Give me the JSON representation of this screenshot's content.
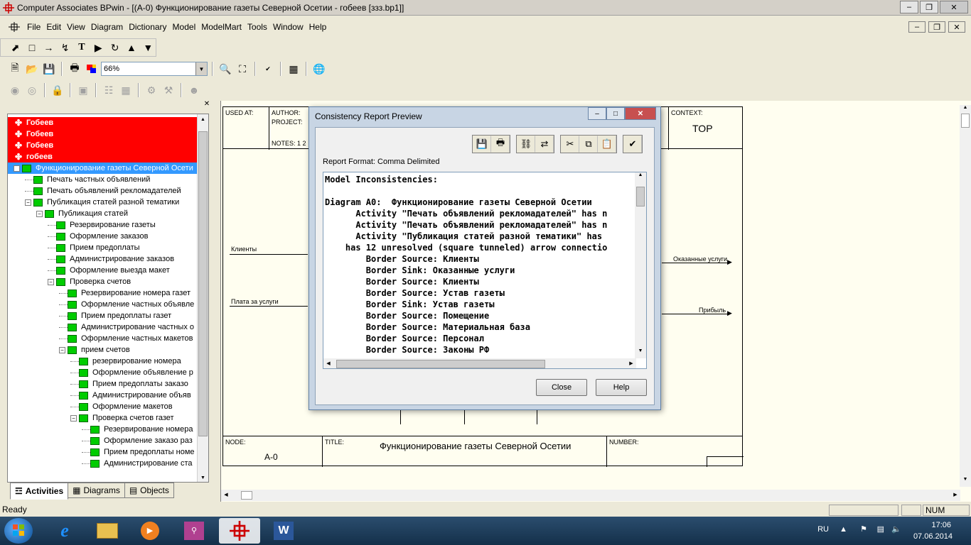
{
  "window": {
    "title": "Computer Associates BPwin - [(A-0) Функционирование газеты Северной Осетии - гобеев  [ззз.bp1]]"
  },
  "menu": [
    "File",
    "Edit",
    "View",
    "Diagram",
    "Dictionary",
    "Model",
    "ModelMart",
    "Tools",
    "Window",
    "Help"
  ],
  "toolbar": {
    "zoom": "66%"
  },
  "tree": {
    "red_items": [
      "Гобеев",
      "Гобеев",
      "Гобеев",
      "гобеев"
    ],
    "items": [
      {
        "label": "Функционирование газеты Северной Осети",
        "level": 0,
        "selected": true,
        "toggle": "−"
      },
      {
        "label": "Печать частных объявлений",
        "level": 1
      },
      {
        "label": "Печать объявлений рекломадателей",
        "level": 1
      },
      {
        "label": "Публикация статей разной тематики",
        "level": 1,
        "toggle": "−"
      },
      {
        "label": "Публикация статей",
        "level": 2,
        "toggle": "−"
      },
      {
        "label": "Резервирование газеты",
        "level": 3
      },
      {
        "label": "Оформление заказов",
        "level": 3
      },
      {
        "label": "Прием предоплаты",
        "level": 3
      },
      {
        "label": "Администрирование заказов",
        "level": 3
      },
      {
        "label": "Оформление выезда макет",
        "level": 3
      },
      {
        "label": "Проверка счетов",
        "level": 3,
        "toggle": "−"
      },
      {
        "label": "Резервирование номера газет",
        "level": 4
      },
      {
        "label": "Оформление частных объявле",
        "level": 4
      },
      {
        "label": "Прием предоплаты газет",
        "level": 4
      },
      {
        "label": "Администрирование частных о",
        "level": 4
      },
      {
        "label": "Оформление частных макетов",
        "level": 4
      },
      {
        "label": "прием счетов",
        "level": 4,
        "toggle": "−"
      },
      {
        "label": "резервирование номера",
        "level": 5
      },
      {
        "label": "Оформление объявление р",
        "level": 5
      },
      {
        "label": "Прием предоплаты заказо",
        "level": 5
      },
      {
        "label": "Администрирование объяв",
        "level": 5
      },
      {
        "label": "Оформление макетов",
        "level": 5
      },
      {
        "label": "Проверка счетов газет",
        "level": 5,
        "toggle": "−"
      },
      {
        "label": "Резервирование номера",
        "level": 6
      },
      {
        "label": "Оформление заказо раз",
        "level": 6
      },
      {
        "label": "Прием предоплаты номе",
        "level": 6
      },
      {
        "label": "Администрирование ста",
        "level": 6
      }
    ]
  },
  "tabs": [
    "Activities",
    "Diagrams",
    "Objects"
  ],
  "diagram": {
    "used_at": "USED AT:",
    "author": "AUTHOR:",
    "project": "PROJECT:",
    "notes": "NOTES:  1  2",
    "context": "CONTEXT:",
    "context_value": "TOP",
    "node_label": "NODE:",
    "node_value": "A-0",
    "title_label": "TITLE:",
    "title_value": "Функционирование газеты Северной Осетии",
    "number_label": "NUMBER:",
    "arrows": {
      "clients": "Клиенты",
      "payment": "Плата за услуги",
      "services": "Оказанные услуги",
      "profit": "Прибыль"
    }
  },
  "dialog": {
    "title": "Consistency Report Preview",
    "format": "Report Format: Comma Delimited",
    "lines": [
      "Model Inconsistencies:",
      "",
      "Diagram A0:  Функционирование газеты Северной Осетии",
      "      Activity \"Печать объявлений рекломадателей\" has n",
      "      Activity \"Печать объявлений рекломадателей\" has n",
      "      Activity \"Публикация статей разной тематики\" has",
      "    has 12 unresolved (square tunneled) arrow connectio",
      "        Border Source: Клиенты",
      "        Border Sink: Оказанные услуги",
      "        Border Source: Клиенты",
      "        Border Source: Устав газеты",
      "        Border Sink: Устав газеты",
      "        Border Source: Помещение",
      "        Border Source: Материальная база",
      "        Border Source: Персонал",
      "        Border Source: Законы РФ"
    ],
    "close": "Close",
    "help": "Help"
  },
  "status": {
    "text": "Ready",
    "num": "NUM"
  },
  "tray": {
    "lang": "RU",
    "time": "17:06",
    "date": "07.06.2014"
  }
}
